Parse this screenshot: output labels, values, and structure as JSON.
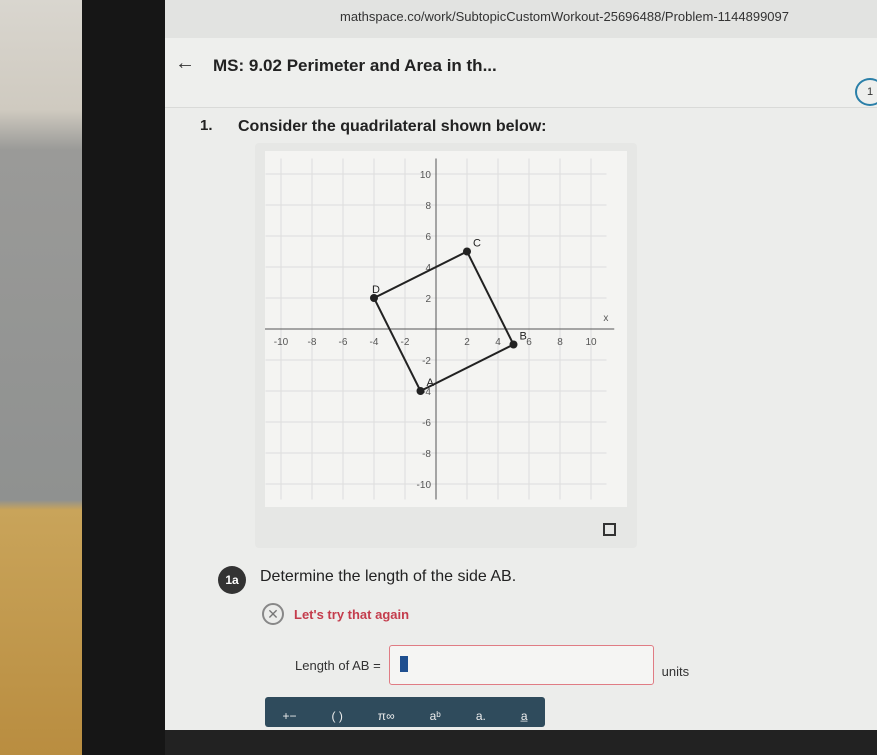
{
  "browser": {
    "url": "mathspace.co/work/SubtopicCustomWorkout-25696488/Problem-1144899097"
  },
  "header": {
    "title": "MS: 9.02 Perimeter and Area in th...",
    "progress_label": "1"
  },
  "question": {
    "number": "1.",
    "text": "Consider the quadrilateral shown below:"
  },
  "chart_data": {
    "type": "scatter",
    "xlim": [
      -10,
      10
    ],
    "ylim": [
      -10,
      10
    ],
    "grid": true,
    "xlabel": "x",
    "ylabel": "",
    "xticks": [
      "-10",
      "-8",
      "-6",
      "-4",
      "-2",
      "2",
      "4",
      "6",
      "8",
      "10"
    ],
    "yticks": [
      "10",
      "8",
      "6",
      "4",
      "2",
      "-2",
      "-4",
      "-6",
      "-8",
      "-10"
    ],
    "points": [
      {
        "label": "A",
        "x": -1,
        "y": -4
      },
      {
        "label": "B",
        "x": 5,
        "y": -1
      },
      {
        "label": "C",
        "x": 2,
        "y": 5
      },
      {
        "label": "D",
        "x": -4,
        "y": 2
      }
    ],
    "polygon": [
      "A",
      "B",
      "C",
      "D"
    ]
  },
  "part": {
    "badge": "1a",
    "text": "Determine the length of the side AB.",
    "feedback": "Let's try that again",
    "answer_label": "Length of AB =",
    "answer_value": "",
    "units": "units"
  },
  "keyboard": {
    "keys": [
      "+−",
      "( )",
      "π∞",
      "aᵇ",
      "a.",
      "a̲"
    ]
  },
  "colors": {
    "error": "#c43c4c",
    "cursor": "#1f4f8f",
    "keyboard": "#2f4b5c"
  }
}
